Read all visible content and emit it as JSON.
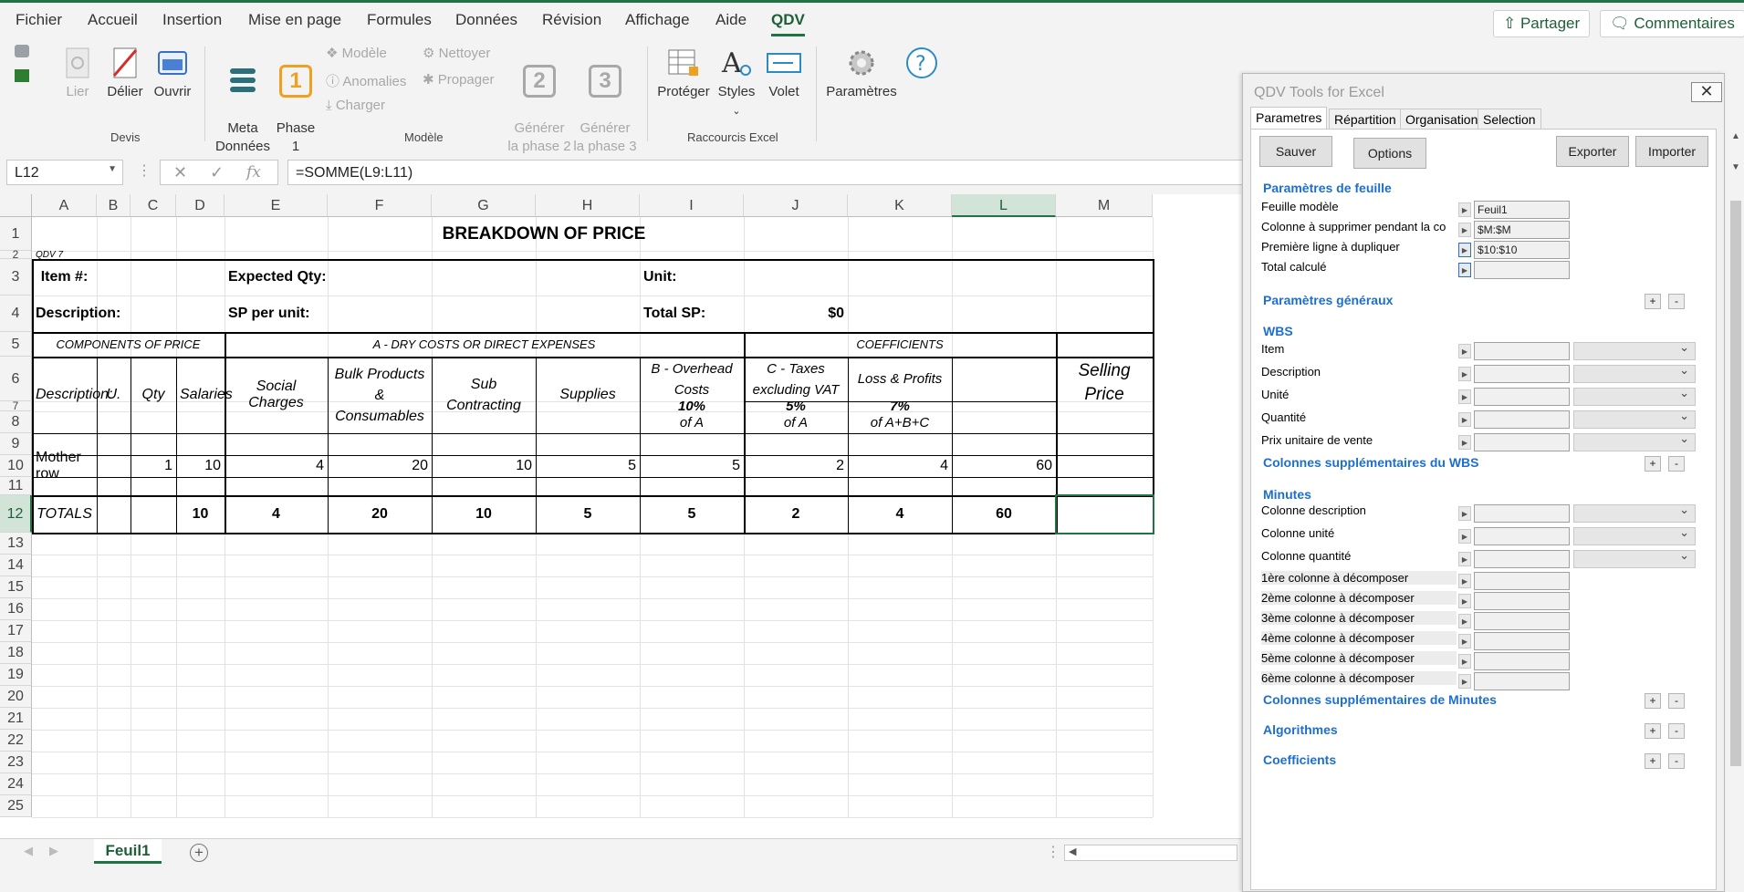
{
  "menu": {
    "tabs": [
      "Fichier",
      "Accueil",
      "Insertion",
      "Mise en page",
      "Formules",
      "Données",
      "Révision",
      "Affichage",
      "Aide",
      "QDV"
    ],
    "share": "Partager",
    "comments": "Commentaires"
  },
  "ribbon": {
    "lier": "Lier",
    "delier": "Délier",
    "ouvrir": "Ouvrir",
    "devis_group": "Devis",
    "meta": "Meta\nDonnées",
    "phase1": "Phase\n1",
    "phase1_num": "1",
    "modele": "Modèle",
    "anomalies": "Anomalies",
    "charger": "Charger",
    "nettoyer": "Nettoyer",
    "propager": "Propager",
    "gen2": "Générer\nla phase 2",
    "gen2_num": "2",
    "gen3": "Générer\nla phase 3",
    "gen3_num": "3",
    "modele_group": "Modèle",
    "proteger": "Protéger",
    "styles": "Styles",
    "volet": "Volet",
    "raccourcis_group": "Raccourcis Excel",
    "parametres": "Paramètres"
  },
  "formula_bar": {
    "name_box": "L12",
    "formula": "=SOMME(L9:L11)"
  },
  "columns": [
    "A",
    "B",
    "C",
    "D",
    "E",
    "F",
    "G",
    "H",
    "I",
    "J",
    "K",
    "L",
    "M"
  ],
  "rows": [
    "1",
    "2",
    "3",
    "4",
    "5",
    "6",
    "7",
    "8",
    "9",
    "10",
    "11",
    "12",
    "13",
    "14",
    "15",
    "16",
    "17",
    "18",
    "19",
    "20",
    "21",
    "22",
    "23",
    "24",
    "25"
  ],
  "sheet": {
    "title": "BREAKDOWN OF PRICE",
    "qdv": "QDV 7",
    "item": "Item #:",
    "expected_qty": "Expected Qty:",
    "unit": "Unit:",
    "description": "Description:",
    "sp_per_unit": "SP per unit:",
    "total_sp": "Total SP:",
    "total_sp_value": "$0",
    "components": "COMPONENTS OF PRICE",
    "dry_costs": "A - DRY COSTS OR DIRECT EXPENSES",
    "coefficients": "COEFFICIENTS",
    "selling_price": "Selling\nPrice",
    "h_desc": "Description:",
    "h_u": "U.",
    "h_qty": "Qty",
    "h_salaries": "Salaries",
    "h_social": "Social Charges",
    "h_bulk": "Bulk Products\n&\nConsumables",
    "h_sub": "Sub\nContracting",
    "h_supplies": "Supplies",
    "h_overhead": "B - Overhead\nCosts",
    "h_overhead_pct": "10%",
    "h_overhead_of": "of A",
    "h_taxes": "C - Taxes\nexcluding VAT",
    "h_taxes_pct": "5%",
    "h_taxes_of": "of A",
    "h_loss": "Loss & Profits",
    "h_loss_pct": "7%",
    "h_loss_of": "of A+B+C",
    "mother_row": {
      "label": "Mother row",
      "qty": "1",
      "salaries": "10",
      "social": "4",
      "bulk": "20",
      "sub": "10",
      "supplies": "5",
      "overhead": "5",
      "taxes": "2",
      "loss": "4",
      "price": "60"
    },
    "totals": {
      "label": "TOTALS",
      "salaries": "10",
      "social": "4",
      "bulk": "20",
      "sub": "10",
      "supplies": "5",
      "overhead": "5",
      "taxes": "2",
      "loss": "4",
      "price": "60"
    }
  },
  "sheet_tab": "Feuil1",
  "panel": {
    "title": "QDV Tools for Excel",
    "tabs": [
      "Parametres",
      "Répartition",
      "Organisation",
      "Selection"
    ],
    "btn_save": "Sauver",
    "btn_options": "Options",
    "btn_export": "Exporter",
    "btn_import": "Importer",
    "sec_feuille": "Paramètres de feuille",
    "feuille_modele": "Feuille modèle",
    "feuille_modele_val": "Feuil1",
    "col_supprimer": "Colonne à supprimer pendant la co",
    "col_supprimer_val": "$M:$M",
    "premiere_ligne": "Première ligne à dupliquer",
    "premiere_ligne_val": "$10:$10",
    "total_calcule": "Total calculé",
    "sec_generaux": "Paramètres généraux",
    "sec_wbs": "WBS",
    "wbs_item": "Item",
    "wbs_desc": "Description",
    "wbs_unite": "Unité",
    "wbs_qte": "Quantité",
    "wbs_prix": "Prix unitaire de vente",
    "sec_wbs_extra": "Colonnes supplémentaires du WBS",
    "sec_minutes": "Minutes",
    "min_desc": "Colonne description",
    "min_unite": "Colonne unité",
    "min_qte": "Colonne quantité",
    "dec1": "1ère colonne à décomposer",
    "dec2": "2ème colonne à décomposer",
    "dec3": "3ème colonne à décomposer",
    "dec4": "4ème colonne à décomposer",
    "dec5": "5ème colonne à décomposer",
    "dec6": "6ème colonne à décomposer",
    "sec_min_extra": "Colonnes supplémentaires de Minutes",
    "sec_algo": "Algorithmes",
    "sec_coef": "Coefficients",
    "plus": "+",
    "minus": "-"
  }
}
